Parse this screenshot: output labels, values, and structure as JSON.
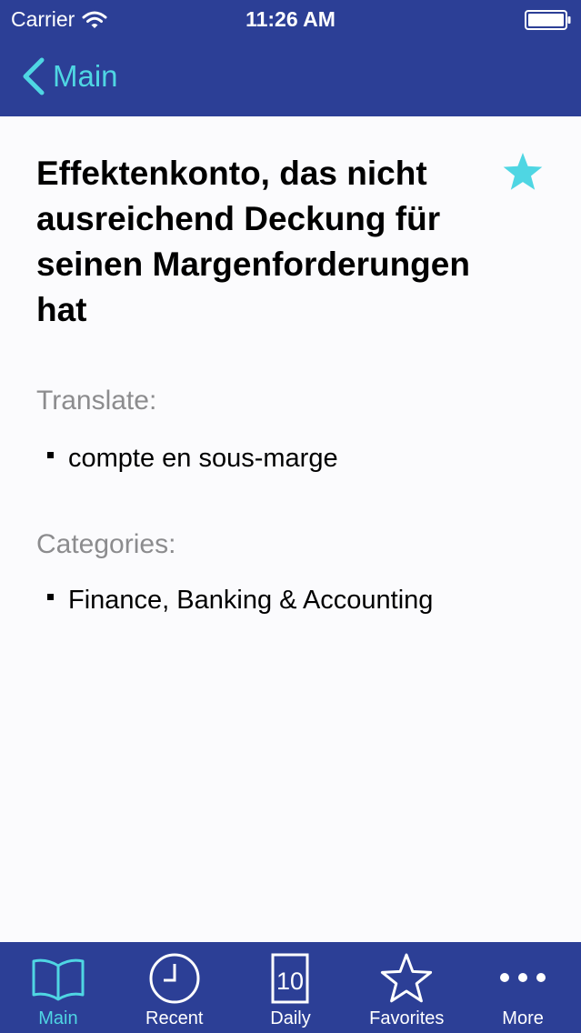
{
  "colors": {
    "bar_background": "#2c3f96",
    "accent": "#4fd6e3",
    "heading_gray": "#8c8c8e"
  },
  "status_bar": {
    "carrier": "Carrier",
    "time": "11:26 AM"
  },
  "nav": {
    "back_label": "Main"
  },
  "entry": {
    "title": "Effektenkonto, das nicht ausreichend Deckung für seinen Margenforderungen hat",
    "favorite_icon": "star-icon",
    "translate_heading": "Translate:",
    "translations": [
      "compte en sous-marge"
    ],
    "categories_heading": "Categories:",
    "categories": [
      "Finance, Banking & Accounting"
    ]
  },
  "tabbar": {
    "tabs": [
      {
        "label": "Main",
        "icon": "book-icon",
        "active": true
      },
      {
        "label": "Recent",
        "icon": "clock-icon",
        "active": false
      },
      {
        "label": "Daily",
        "icon": "calendar-icon",
        "active": false
      },
      {
        "label": "Favorites",
        "icon": "star-icon",
        "active": false
      },
      {
        "label": "More",
        "icon": "more-icon",
        "active": false
      }
    ],
    "daily_icon_number": "10"
  }
}
